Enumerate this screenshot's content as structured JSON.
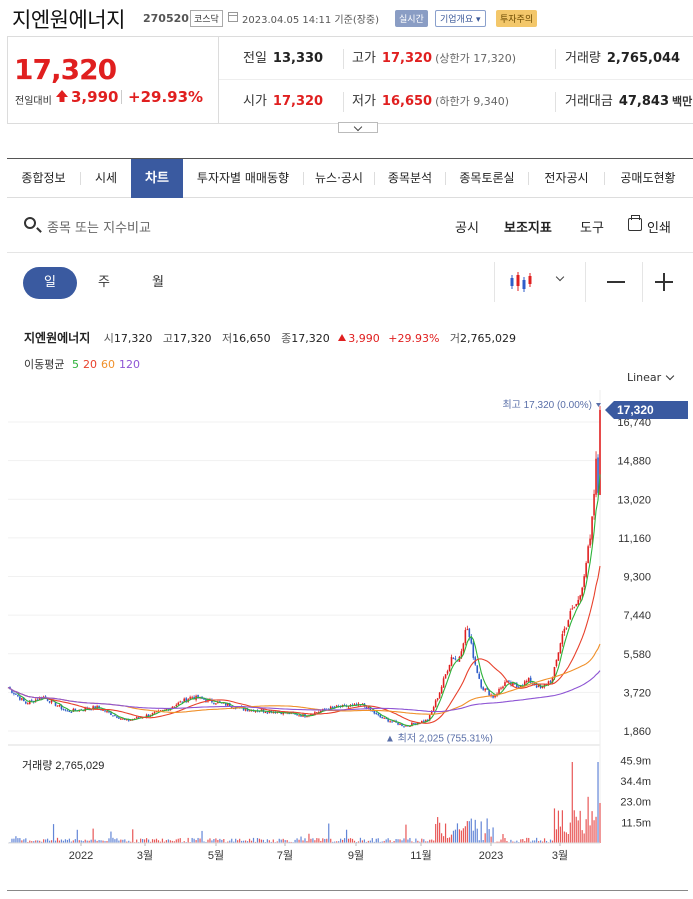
{
  "header": {
    "name": "지엔원에너지",
    "code": "270520",
    "market": "코스닥",
    "time": "2023.04.05 14:11 기준(장중)",
    "live_badge": "실시간",
    "corp_badge": "기업개요 ▾",
    "warn_badge": "투자주의"
  },
  "summary": {
    "price": "17,320",
    "change_label": "전일대비",
    "change": "3,990",
    "change_pct": "+29.93%",
    "prev_close": {
      "label": "전일",
      "value": "13,330"
    },
    "high": {
      "label": "고가",
      "value": "17,320",
      "sub": "(상한가 17,320)"
    },
    "volume": {
      "label": "거래량",
      "value": "2,765,044"
    },
    "open": {
      "label": "시가",
      "value": "17,320"
    },
    "low": {
      "label": "저가",
      "value": "16,650",
      "sub": "(하한가 9,340)"
    },
    "amount": {
      "label": "거래대금",
      "value": "47,843",
      "unit": "백만"
    }
  },
  "tabs": [
    {
      "label": "종합정보",
      "active": false
    },
    {
      "label": "시세",
      "active": false
    },
    {
      "label": "차트",
      "active": true
    },
    {
      "label": "투자자별 매매동향",
      "active": false
    },
    {
      "label": "뉴스·공시",
      "active": false
    },
    {
      "label": "종목분석",
      "active": false
    },
    {
      "label": "종목토론실",
      "active": false
    },
    {
      "label": "전자공시",
      "active": false
    },
    {
      "label": "공매도현황",
      "active": false
    }
  ],
  "toolbar": {
    "search_placeholder": "종목 또는 지수비교",
    "notice": "공시",
    "indicator": "보조지표",
    "tools": "도구",
    "print": "인쇄"
  },
  "period": {
    "day": "일",
    "week": "주",
    "month": "월",
    "active": "일"
  },
  "chart_info": {
    "name": "지엔원에너지",
    "open_k": "시",
    "open": "17,320",
    "high_k": "고",
    "high": "17,320",
    "low_k": "저",
    "low": "16,650",
    "close_k": "종",
    "close": "17,320",
    "change": "3,990",
    "change_pct": "+29.93%",
    "vol_k": "거",
    "volume": "2,765,029"
  },
  "ma_legend": {
    "label": "이동평균",
    "items": [
      {
        "label": "5",
        "color": "#2db23a"
      },
      {
        "label": "20",
        "color": "#e8412c"
      },
      {
        "label": "60",
        "color": "#f0902a"
      },
      {
        "label": "120",
        "color": "#8e55d4"
      }
    ]
  },
  "scale": {
    "label": "Linear"
  },
  "colors": {
    "up": "#e01f1f",
    "down": "#2f5dc9",
    "accent": "#3a5aa0"
  },
  "chart_data": {
    "type": "candlestick",
    "price_axis_ticks": [
      "16,740",
      "14,880",
      "13,020",
      "11,160",
      "9,300",
      "7,440",
      "5,580",
      "3,720",
      "1,860"
    ],
    "price_axis_values": [
      16740,
      14880,
      13020,
      11160,
      9300,
      7440,
      5580,
      3720,
      1860
    ],
    "current_price_label": "17,320",
    "current_price": 17320,
    "max_marker": "최고 17,320 (0.00%)",
    "min_marker": "▲ 최저 2,025 (755.31%)",
    "min_price": 2025,
    "volume_label": "거래량 2,765,029",
    "volume_axis_ticks": [
      "45.9m",
      "34.4m",
      "23.0m",
      "11.5m"
    ],
    "volume_axis_values": [
      45.9,
      34.4,
      23.0,
      11.5
    ],
    "x_labels": [
      "2022",
      "3월",
      "5월",
      "7월",
      "9월",
      "11월",
      "2023",
      "3월"
    ],
    "price_path": [
      [
        0,
        3950
      ],
      [
        0.03,
        3200
      ],
      [
        0.06,
        3500
      ],
      [
        0.1,
        2800
      ],
      [
        0.15,
        3000
      ],
      [
        0.2,
        2350
      ],
      [
        0.26,
        2800
      ],
      [
        0.31,
        3500
      ],
      [
        0.36,
        3200
      ],
      [
        0.4,
        2900
      ],
      [
        0.45,
        2800
      ],
      [
        0.5,
        2600
      ],
      [
        0.55,
        3000
      ],
      [
        0.6,
        3100
      ],
      [
        0.63,
        2500
      ],
      [
        0.67,
        2100
      ],
      [
        0.71,
        2400
      ],
      [
        0.73,
        3800
      ],
      [
        0.75,
        5500
      ],
      [
        0.76,
        5200
      ],
      [
        0.775,
        6900
      ],
      [
        0.79,
        5000
      ],
      [
        0.8,
        4000
      ],
      [
        0.82,
        3500
      ],
      [
        0.84,
        4200
      ],
      [
        0.86,
        4000
      ],
      [
        0.88,
        4300
      ],
      [
        0.9,
        3900
      ],
      [
        0.92,
        4400
      ],
      [
        0.935,
        6400
      ],
      [
        0.95,
        7500
      ],
      [
        0.965,
        8200
      ],
      [
        0.975,
        9800
      ],
      [
        0.985,
        11200
      ],
      [
        0.99,
        13330
      ],
      [
        1.0,
        17320
      ]
    ]
  }
}
